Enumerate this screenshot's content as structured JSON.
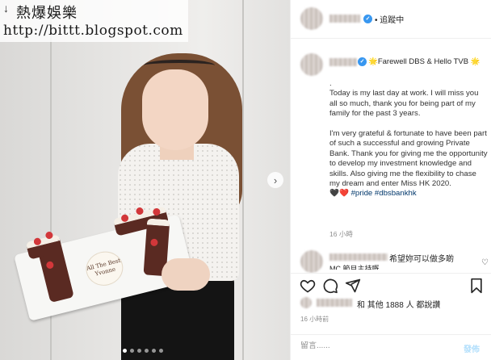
{
  "watermark": {
    "title": "熱爆娛樂",
    "url": "http://bittt.blogspot.com"
  },
  "photo": {
    "plaque_line1": "All The Best",
    "plaque_line2": "Yvonne",
    "carousel_dots": 6,
    "active_dot": 1
  },
  "header": {
    "follow_label": "• 追蹤中"
  },
  "caption": {
    "headline": "🌟Farewell DBS & Hello TVB 🌟",
    "body": ".\nToday is my last day at work. I will miss you all so much, thank you for being part of my family for the past 3 years.\n\nI'm very grateful & fortunate to have been part of such a successful and growing Private Bank. Thank you for giving me the opportunity to develop my investment knowledge and skills. Also giving me the flexibility to chase my dream and enter Miss HK 2020.",
    "hearts": "🖤❤️",
    "hashtags": "#pride #dbsbankhk",
    "time": "16 小時"
  },
  "comment": {
    "text": "希望妳可以做多啲",
    "text2": "MC 節目主持嘅",
    "like_icon": "heart-outline-icon"
  },
  "actions": {
    "icons": [
      "heart-icon",
      "comment-icon",
      "share-icon",
      "bookmark-icon"
    ]
  },
  "likes": {
    "text": "和 其他 1888 人 都說讚"
  },
  "post_time": "16 小時前",
  "comment_box": {
    "placeholder": "留言......",
    "post_label": "發佈"
  },
  "colors": {
    "verified": "#3897f0",
    "hashtag": "#00376b",
    "muted": "#8e8e8e",
    "post_button": "#b2dffc"
  }
}
